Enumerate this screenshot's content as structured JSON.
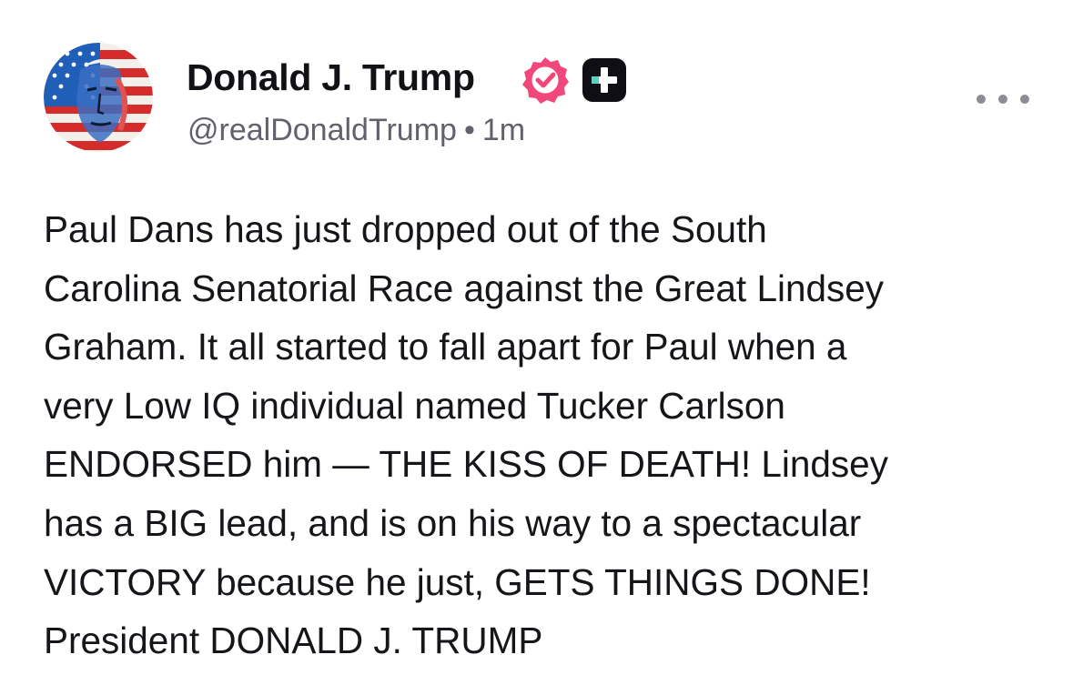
{
  "author": {
    "display_name": "Donald J. Trump",
    "handle": "@realDonaldTrump",
    "separator": "•",
    "timestamp": "1m",
    "avatar_icon": "flag-portrait-avatar",
    "verified_icon": "verified-badge-icon",
    "verified_color": "#f1477a",
    "plus_icon": "plus-badge-icon",
    "plus_accent": "#57d3c4"
  },
  "post": {
    "lines": [
      "Paul Dans has just dropped out of the South",
      "Carolina Senatorial Race against the Great Lindsey",
      "Graham. It all started to fall apart for Paul when a",
      "very Low IQ individual named Tucker Carlson",
      "ENDORSED him — THE KISS OF DEATH! Lindsey",
      "has a BIG lead, and is on his way to a spectacular",
      "VICTORY because he just, GETS THINGS DONE!",
      "President DONALD J. TRUMP"
    ]
  },
  "actions": {
    "more_icon": "more-horizontal-icon"
  }
}
